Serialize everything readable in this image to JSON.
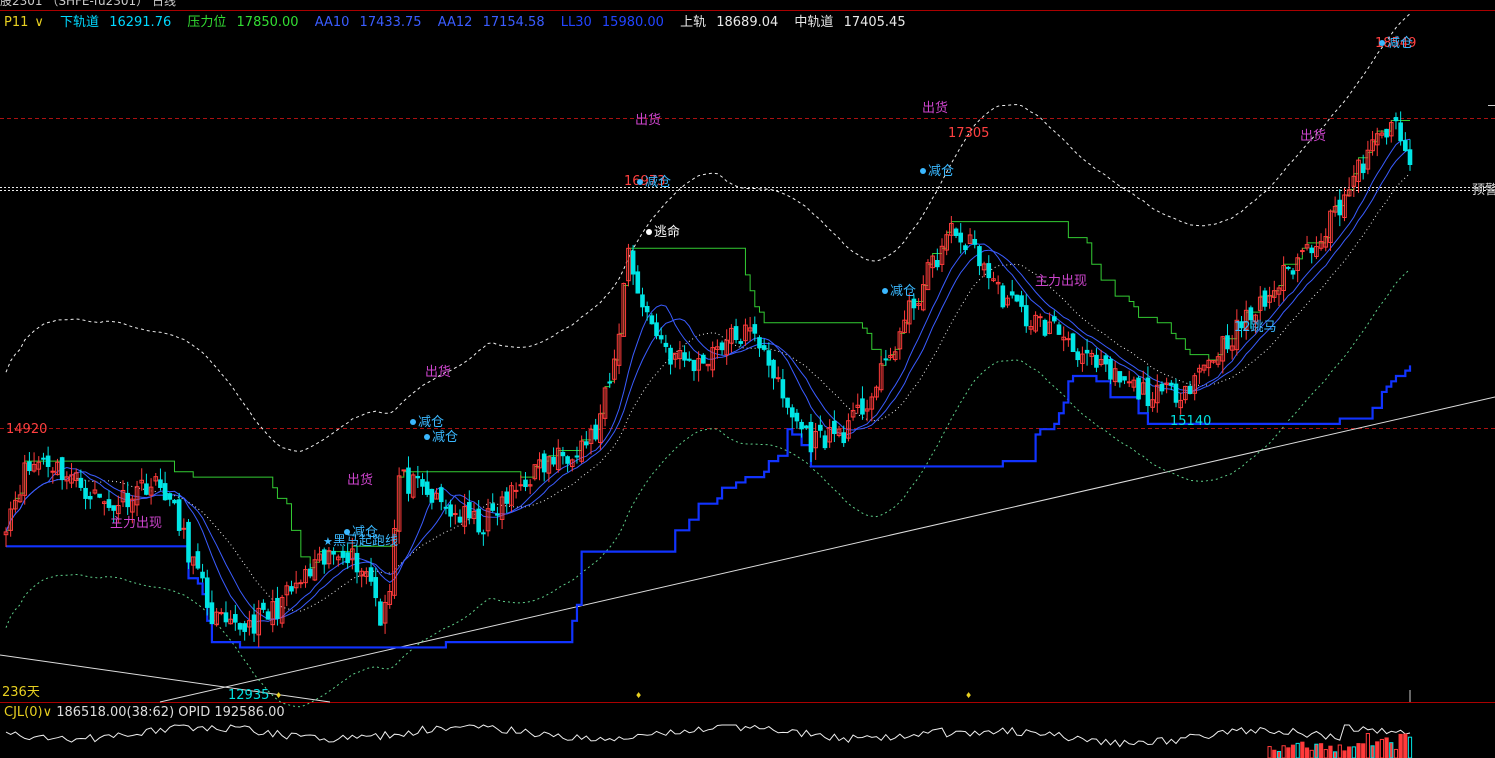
{
  "header": {
    "title_fragment": "股2301 （SHFE-fu2301） 日线",
    "period_label": "P11",
    "indicators": [
      {
        "label": "下轨道",
        "value": "16291.76",
        "color": "#00d8ff"
      },
      {
        "label": "压力位",
        "value": "17850.00",
        "color": "#33dd33"
      },
      {
        "label": "AA10",
        "value": "17433.75",
        "color": "#3a5cff"
      },
      {
        "label": "AA12",
        "value": "17154.58",
        "color": "#3a5cff"
      },
      {
        "label": "LL30",
        "value": "15980.00",
        "color": "#2244ff"
      },
      {
        "label": "上轨",
        "value": "18689.04",
        "color": "#e8e8e8"
      },
      {
        "label": "中轨道",
        "value": "17405.45",
        "color": "#e8e8e8"
      }
    ]
  },
  "sub_panel": {
    "label": "CJL(0)",
    "value1": "186518.00(38:62)",
    "value2_label": "OPID",
    "value2": "192586.00"
  },
  "colors": {
    "up": "#ff3b3b",
    "down": "#00e5e5",
    "resistance": "#33cc33",
    "support": "#1133ff",
    "ma": "#3a5cff",
    "signal": "#cc44cc",
    "grid_dash": "#aa1111"
  },
  "chart_data": {
    "type": "candlestick",
    "ylim": [
      12600,
      18800
    ],
    "price_labels": [
      {
        "text": "14920",
        "kind": "high"
      },
      {
        "text": "16973",
        "kind": "high"
      },
      {
        "text": "17305",
        "kind": "high"
      },
      {
        "text": "18549",
        "kind": "high"
      },
      {
        "text": "12935",
        "kind": "low"
      },
      {
        "text": "15140",
        "kind": "low"
      }
    ],
    "signals": [
      {
        "text": "出货",
        "kind": "sell"
      },
      {
        "text": "出货",
        "kind": "sell"
      },
      {
        "text": "出货",
        "kind": "sell"
      },
      {
        "text": "出货",
        "kind": "sell"
      },
      {
        "text": "出货",
        "kind": "sell"
      },
      {
        "text": "减仓",
        "kind": "reduce"
      },
      {
        "text": "减仓",
        "kind": "reduce"
      },
      {
        "text": "减仓",
        "kind": "reduce"
      },
      {
        "text": "减仓",
        "kind": "reduce"
      },
      {
        "text": "减仓",
        "kind": "reduce"
      },
      {
        "text": "减仓",
        "kind": "reduce"
      },
      {
        "text": "减仓",
        "kind": "reduce"
      },
      {
        "text": "逃命",
        "kind": "escape"
      },
      {
        "text": "黑马起跑线",
        "kind": "horse"
      },
      {
        "text": "主力出现",
        "kind": "main"
      },
      {
        "text": "主力出现",
        "kind": "main"
      },
      {
        "text": "12跳马",
        "kind": "horse"
      }
    ],
    "right_label": "预警",
    "days_label": "236天"
  }
}
